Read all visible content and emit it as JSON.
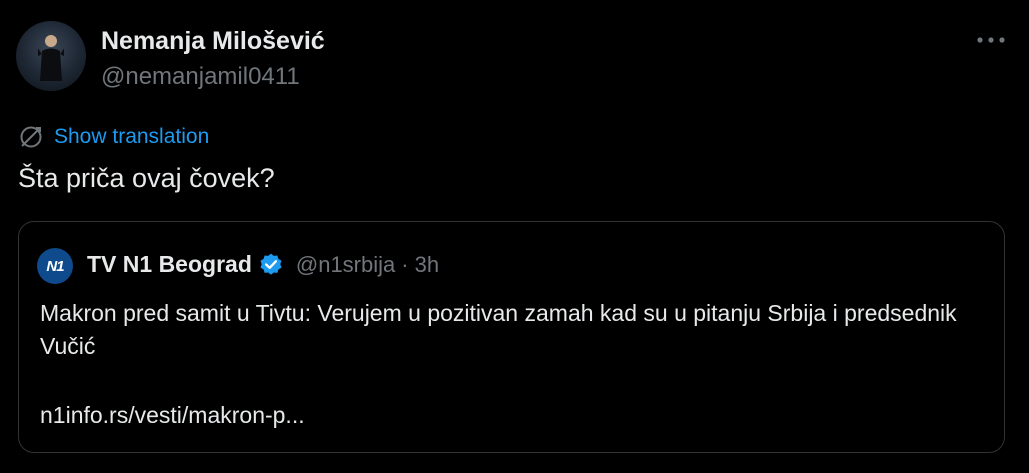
{
  "author": {
    "name": "Nemanja Milošević",
    "handle": "@nemanjamil0411",
    "avatar_icon": "profile-photo"
  },
  "more_icon": "more-horizontal-icon",
  "translation": {
    "icon": "translate-icon",
    "label": "Show translation"
  },
  "tweet": {
    "text": "Šta priča ovaj čovek?"
  },
  "quote": {
    "avatar_text": "N1",
    "name": "TV N1 Beograd",
    "verified_icon": "verified-badge-icon",
    "handle": "@n1srbija",
    "separator": "·",
    "time": "3h",
    "text": "Makron pred samit u Tivtu: Verujem u pozitivan zamah kad su u pitanju Srbija i predsednik Vučić",
    "link": "n1info.rs/vesti/makron-p..."
  },
  "colors": {
    "background": "#000000",
    "text": "#e7e9ea",
    "secondary_text": "#71767b",
    "accent": "#1d9bf0",
    "border": "#2f3336",
    "n1_blue": "#0e4a8c"
  }
}
